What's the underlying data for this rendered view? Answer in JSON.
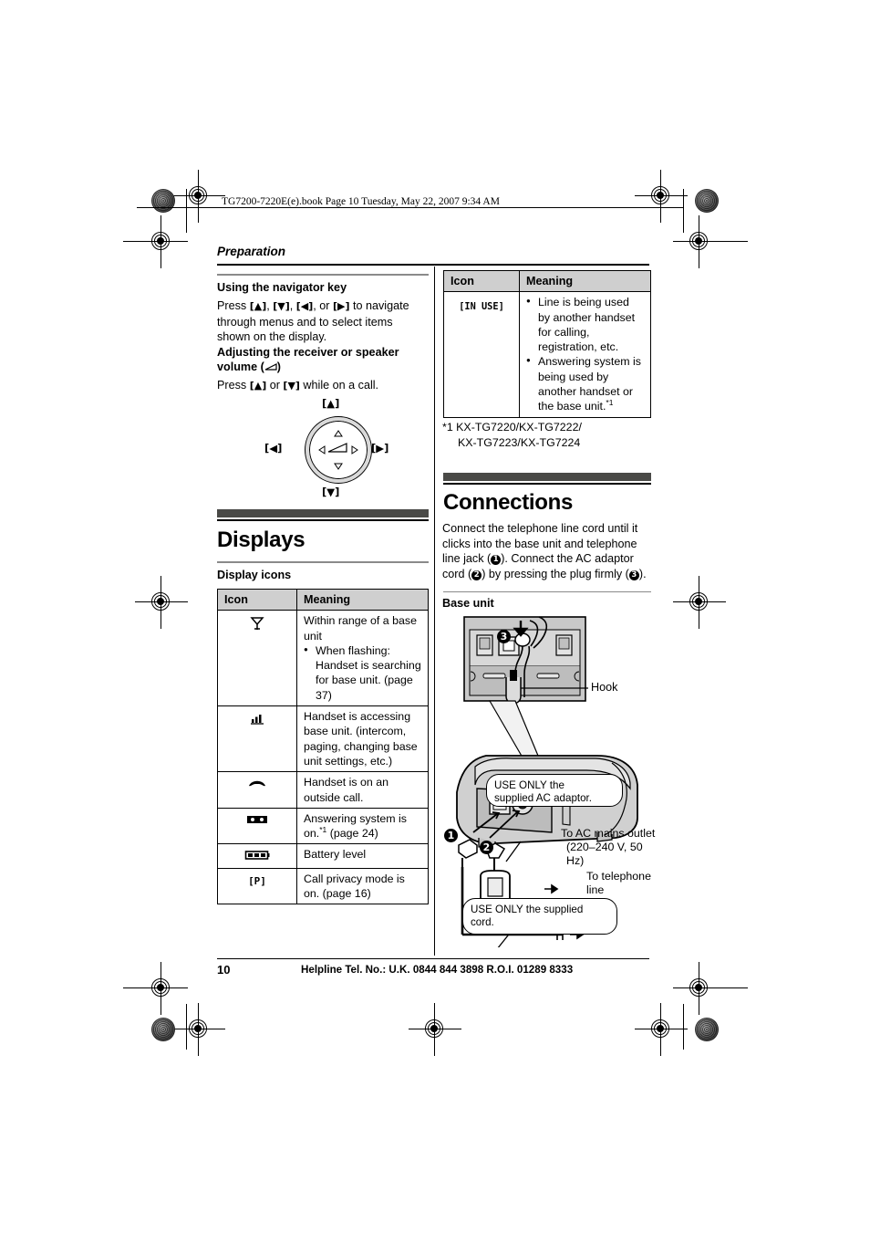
{
  "document": {
    "file_header": "TG7200-7220E(e).book  Page 10  Tuesday, May 22, 2007  9:34 AM",
    "running_head": "Preparation",
    "page_number": "10",
    "footer_helpline": "Helpline Tel. No.: U.K. 0844 844 3898 R.O.I. 01289 8333"
  },
  "left_column": {
    "navigator": {
      "heading": "Using the navigator key",
      "body_prefix": "Press ",
      "key_up": "[▲]",
      "key_down": "[▼]",
      "key_left": "[◀]",
      "key_right": "[▶]",
      "body_mid1": ", ",
      "body_mid2": ", ",
      "body_mid3": ", or ",
      "body_suffix": " to navigate through menus and to select items shown on the display."
    },
    "volume": {
      "heading_line1": "Adjusting the receiver or speaker",
      "heading_line2": "volume (",
      "heading_line2_end": ")",
      "body_prefix": "Press ",
      "body_mid": " or ",
      "body_suffix": " while on a call."
    },
    "nav_diagram": {
      "label_up": "[▲]",
      "label_down": "[▼]",
      "label_left": "[◀]",
      "label_right": "[▶]"
    },
    "displays_section": {
      "title": "Displays",
      "subheading": "Display icons"
    },
    "icon_table": {
      "header_icon": "Icon",
      "header_meaning": "Meaning",
      "rows": [
        {
          "icon": "antenna-icon",
          "meaning_line1": "Within range of a base unit",
          "bullets": [
            "When flashing: Handset is searching for base unit. (page 37)"
          ]
        },
        {
          "icon": "signal-waves-icon",
          "meaning_line1": "Handset is accessing base unit. (intercom, paging, changing base unit settings, etc.)",
          "bullets": []
        },
        {
          "icon": "handset-off-hook-icon",
          "meaning_line1": "Handset is on an outside call.",
          "bullets": []
        },
        {
          "icon": "answering-system-icon",
          "meaning_line1": "Answering system is on.",
          "meaning_sup": "*1",
          "meaning_line2": " (page 24)",
          "bullets": []
        },
        {
          "icon": "battery-icon",
          "meaning_line1": "Battery level",
          "bullets": []
        },
        {
          "icon": "[P]",
          "icon_is_text": true,
          "meaning_line1": "Call privacy mode is on. (page 16)",
          "bullets": []
        }
      ]
    }
  },
  "right_column": {
    "in_use_table": {
      "header_icon": "Icon",
      "header_meaning": "Meaning",
      "row_icon": "[IN USE]",
      "bullets": [
        "Line is being used by another handset for calling, registration, etc.",
        "Answering system is being used by another handset or the base unit."
      ],
      "bullet2_sup": "*1"
    },
    "footnote": {
      "marker": "*1",
      "line1": "KX-TG7220/KX-TG7222/",
      "line2": "KX-TG7223/KX-TG7224"
    },
    "connections": {
      "title": "Connections",
      "body_part1": "Connect the telephone line cord until it clicks into the base unit and telephone line jack (",
      "num1": "1",
      "body_part2": "). Connect the AC adaptor cord (",
      "num2": "2",
      "body_part3": ") by pressing the plug firmly (",
      "num3": "3",
      "body_part4": ")."
    },
    "figure": {
      "caption": "Base unit",
      "inset_number": "3",
      "hook_label": "Hook",
      "callout_adaptor_line1": "USE ONLY the",
      "callout_adaptor_line2": "supplied AC adaptor.",
      "ac_outlet_line1": "To AC mains outlet",
      "ac_outlet_line2": "(220–240 V, 50 Hz)",
      "telephone_line_label": "To telephone line",
      "callout_cord_line1": "USE ONLY the supplied",
      "callout_cord_line2": "cord.",
      "num1": "1",
      "num2": "2"
    }
  },
  "colors": {
    "section_bar": "#4a4a47",
    "table_header_bg": "#cfcfcf",
    "illustration_fill": "#d4d4d4"
  }
}
